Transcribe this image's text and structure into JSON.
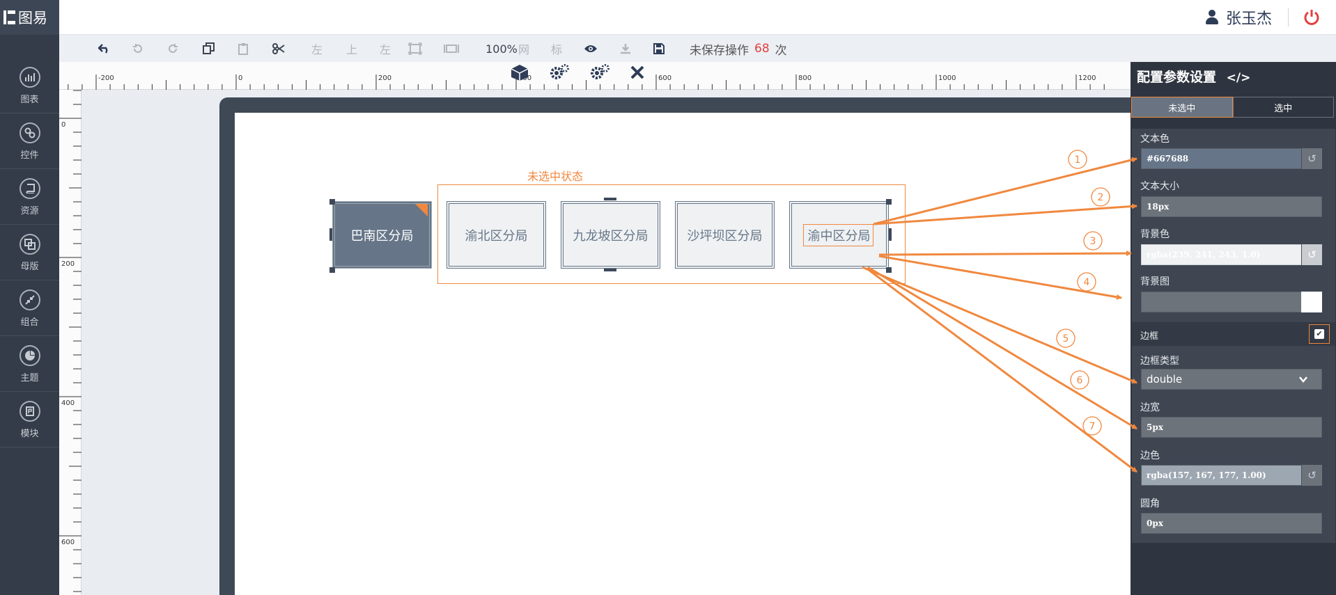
{
  "app": {
    "logo_text": "图易"
  },
  "header": {
    "user_name": "张玉杰"
  },
  "sidebar": {
    "items": [
      {
        "label": "图表",
        "icon": "bar-chart-icon"
      },
      {
        "label": "控件",
        "icon": "link-icon"
      },
      {
        "label": "资源",
        "icon": "book-icon"
      },
      {
        "label": "母版",
        "icon": "copy-icon"
      },
      {
        "label": "组合",
        "icon": "compress-icon"
      },
      {
        "label": "主题",
        "icon": "pie-chart-icon"
      },
      {
        "label": "模块",
        "icon": "module-icon"
      }
    ]
  },
  "toolbar": {
    "align_left_1": "左",
    "align_top": "上",
    "align_left_2": "左",
    "zoom": "100%",
    "grid": "网",
    "mark": "标",
    "unsaved_prefix": "未保存操作",
    "unsaved_count": "68",
    "unsaved_suffix": "次"
  },
  "ruler": {
    "h_ticks": [
      "-200",
      "0",
      "200",
      "400",
      "600",
      "800",
      "1000",
      "1200"
    ],
    "v_ticks": [
      "0",
      "200",
      "400",
      "600"
    ]
  },
  "canvas": {
    "annotation_label": "未选中状态",
    "tabs": [
      {
        "label": "巴南区分局",
        "state": "selected"
      },
      {
        "label": "渝北区分局",
        "state": "unselected"
      },
      {
        "label": "九龙坡区分局",
        "state": "unselected"
      },
      {
        "label": "沙坪坝区分局",
        "state": "unselected"
      },
      {
        "label": "渝中区分局",
        "state": "unselected"
      }
    ],
    "callouts": [
      "1",
      "2",
      "3",
      "4",
      "5",
      "6",
      "7"
    ]
  },
  "panel": {
    "title": "配置参数设置",
    "tabs": [
      {
        "label": "未选中",
        "active": true
      },
      {
        "label": "选中",
        "active": false
      }
    ],
    "fields": {
      "text_color": {
        "label": "文本色",
        "value": "#667688"
      },
      "text_size": {
        "label": "文本大小",
        "value": "18px"
      },
      "bg_color": {
        "label": "背景色",
        "value": "rgba(239, 241, 243, 1.0)"
      },
      "bg_image": {
        "label": "背景图",
        "value": ""
      },
      "border": {
        "label": "边框",
        "checked": true
      },
      "border_type": {
        "label": "边框类型",
        "value": "double"
      },
      "border_width": {
        "label": "边宽",
        "value": "5px"
      },
      "border_color": {
        "label": "边色",
        "value": "rgba(157, 167, 177, 1.00)"
      },
      "radius": {
        "label": "圆角",
        "value": "0px"
      }
    }
  },
  "colors": {
    "accent": "#f0883e",
    "tab_selected_bg": "#667688",
    "tab_unselected_bg": "#eff1f3",
    "sidebar_bg": "#333c48",
    "panel_bg": "#2f3540",
    "danger": "#e34040"
  }
}
